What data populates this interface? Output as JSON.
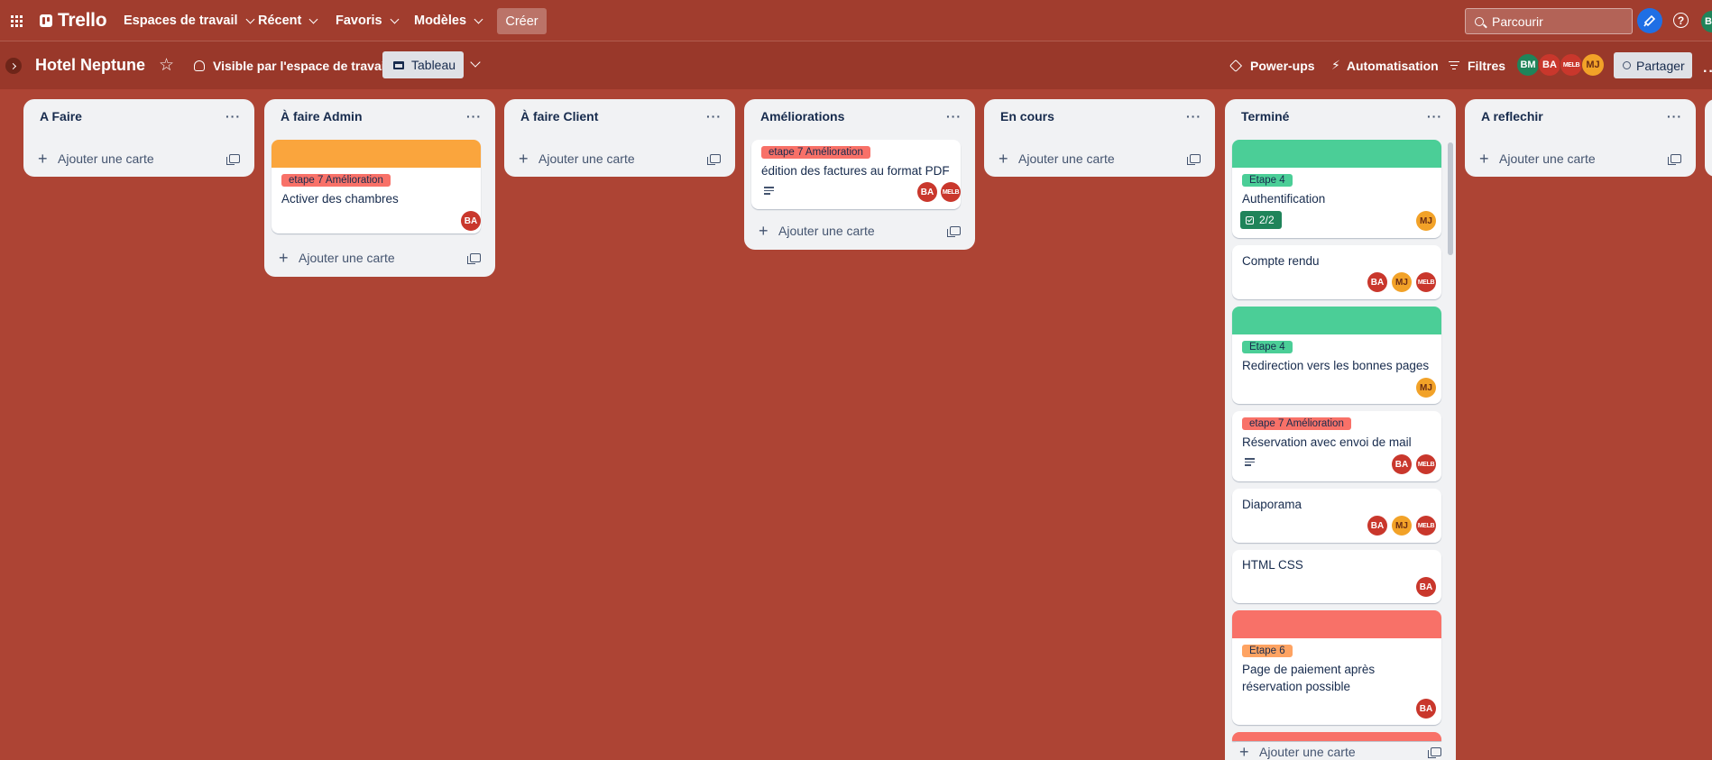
{
  "topnav": {
    "brand": "Trello",
    "menus": [
      "Espaces de travail",
      "Récent",
      "Favoris",
      "Modèles"
    ],
    "create_label": "Créer",
    "search_placeholder": "Parcourir",
    "help_glyph": "?",
    "user_initials": "BM"
  },
  "board": {
    "title": "Hotel Neptune",
    "visibility_label": "Visible par l'espace de travail",
    "view_label": "Tableau",
    "powerups_label": "Power-ups",
    "automation_label": "Automatisation",
    "filters_label": "Filtres",
    "share_label": "Partager",
    "members": [
      {
        "initials": "BM",
        "color": "#1f845a"
      },
      {
        "initials": "BA",
        "color": "#c9372c"
      },
      {
        "initials": "MELB",
        "color": "#c9372c"
      },
      {
        "initials": "MJ",
        "color": "#f2a228"
      }
    ]
  },
  "colors": {
    "background": "#ad4434",
    "label_red": "#f87168",
    "label_green": "#4bce97",
    "label_orange": "#fea362",
    "cover_orange": "#faa53d",
    "cover_green": "#4bce97",
    "cover_red": "#f87168"
  },
  "add_card_label": "Ajouter une carte",
  "lists": [
    {
      "title": "A Faire",
      "cards": []
    },
    {
      "title": "À faire Admin",
      "cards": [
        {
          "cover": "orange",
          "label": "etape 7 Amélioration",
          "title": "Activer des chambres",
          "members": [
            "BA"
          ]
        }
      ]
    },
    {
      "title": "À faire Client",
      "cards": []
    },
    {
      "title": "Améliorations",
      "cards": [
        {
          "label": "etape 7 Amélioration",
          "title": "édition des factures au format PDF",
          "description": true,
          "members": [
            "BA",
            "MELB"
          ]
        }
      ]
    },
    {
      "title": "En cours",
      "cards": []
    },
    {
      "title": "Terminé",
      "cards": [
        {
          "cover": "green",
          "label": "Etape 4",
          "title": "Authentification",
          "checklist": "2/2",
          "members": [
            "MJ"
          ]
        },
        {
          "title": "Compte rendu",
          "members": [
            "BA",
            "MJ",
            "MELB"
          ]
        },
        {
          "cover": "green",
          "label": "Etape 4",
          "title": "Redirection vers les bonnes pages",
          "members": [
            "MJ"
          ]
        },
        {
          "label": "etape 7 Amélioration",
          "title": "Réservation avec envoi de mail",
          "description": true,
          "members": [
            "BA",
            "MELB"
          ]
        },
        {
          "title": "Diaporama",
          "members": [
            "BA",
            "MJ",
            "MELB"
          ]
        },
        {
          "title": "HTML CSS",
          "members": [
            "BA"
          ]
        },
        {
          "cover": "red",
          "label": "Etape 6",
          "title": "Page de paiement après réservation possible",
          "members": [
            "BA"
          ]
        }
      ]
    },
    {
      "title": "A reflechir",
      "cards": []
    }
  ]
}
